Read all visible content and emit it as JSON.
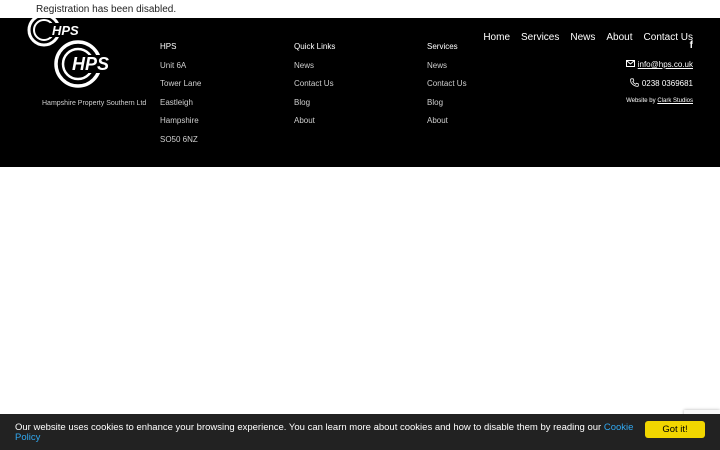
{
  "top_message": "Registration has been disabled.",
  "logo": {
    "text_small": "HPS",
    "text_big": "HPS",
    "tagline": "Hampshire Property Southern Ltd"
  },
  "nav": [
    "Home",
    "Services",
    "News",
    "About",
    "Contact Us"
  ],
  "columns": {
    "address": {
      "heading": "HPS",
      "items": [
        "Unit 6A",
        "Tower Lane",
        "Eastleigh",
        "Hampshire",
        "SO50 6NZ"
      ]
    },
    "quick_links": {
      "heading": "Quick Links",
      "items": [
        "News",
        "Contact Us",
        "Blog",
        "About"
      ]
    },
    "services": {
      "heading": "Services",
      "items": [
        "News",
        "Contact Us",
        "Blog",
        "About"
      ]
    }
  },
  "contact": {
    "social_icon": "f",
    "email": "info@hps.co.uk",
    "phone": "0238 0369681"
  },
  "credit": {
    "prefix": "Website by",
    "link": "Clark Studios"
  },
  "cookie": {
    "message": "Our website uses cookies to enhance your browsing experience. You can learn more about cookies and how to disable them by reading our ",
    "link": "Cookie Policy",
    "button": "Got it!"
  },
  "icons": [
    "facebook-icon",
    "envelope-icon",
    "phone-icon"
  ],
  "colors": {
    "footer_bg": "#000000",
    "cookie_bg": "#222222",
    "cookie_link": "#31a8f0",
    "cookie_button": "#f1d600"
  }
}
